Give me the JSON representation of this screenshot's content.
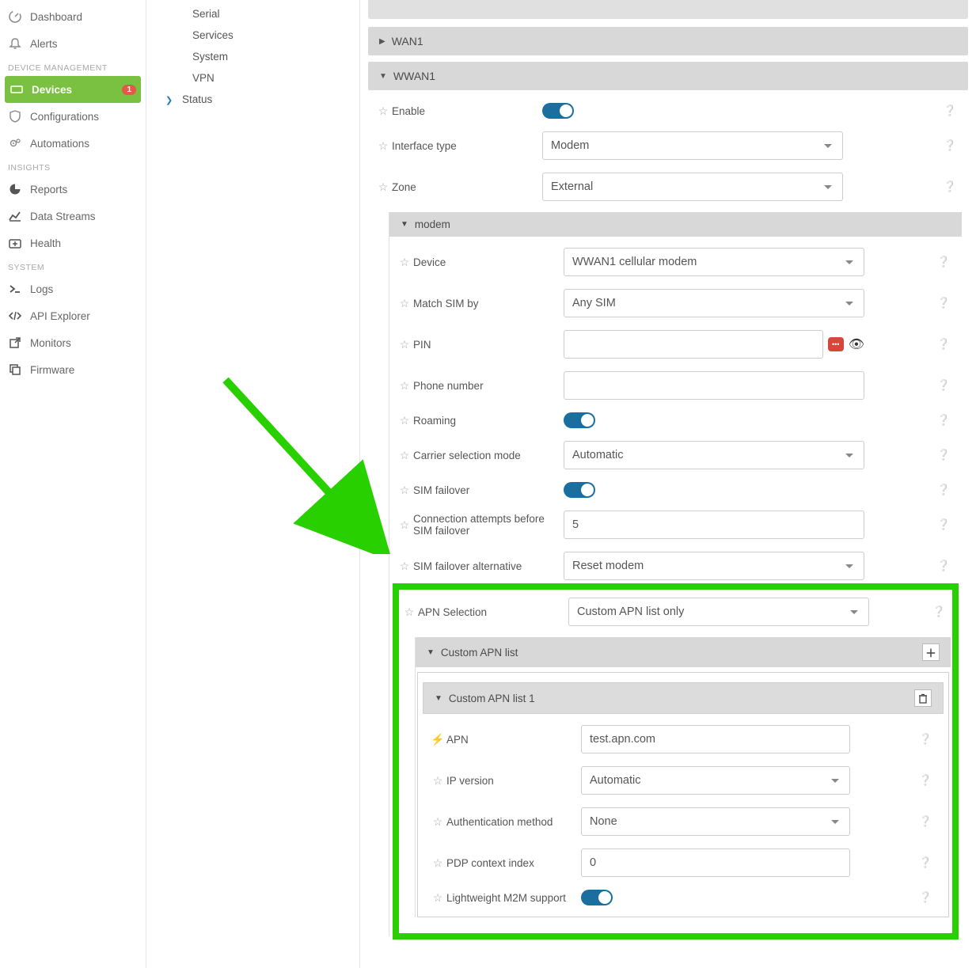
{
  "nav": {
    "top": [
      {
        "icon": "dashboard",
        "label": "Dashboard"
      },
      {
        "icon": "bell",
        "label": "Alerts"
      }
    ],
    "deviceMgmt": {
      "title": "DEVICE MANAGEMENT",
      "items": [
        {
          "icon": "device",
          "label": "Devices",
          "badge": "1",
          "active": true
        },
        {
          "icon": "shield",
          "label": "Configurations"
        },
        {
          "icon": "gears",
          "label": "Automations"
        }
      ]
    },
    "insights": {
      "title": "INSIGHTS",
      "items": [
        {
          "icon": "pie",
          "label": "Reports"
        },
        {
          "icon": "chart",
          "label": "Data Streams"
        },
        {
          "icon": "firstaid",
          "label": "Health"
        }
      ]
    },
    "system": {
      "title": "SYSTEM",
      "items": [
        {
          "icon": "terminal",
          "label": "Logs"
        },
        {
          "icon": "code",
          "label": "API Explorer"
        },
        {
          "icon": "external",
          "label": "Monitors"
        },
        {
          "icon": "copy",
          "label": "Firmware"
        }
      ]
    }
  },
  "tree": {
    "items": [
      "Serial",
      "Services",
      "System",
      "VPN"
    ],
    "parent": "Status"
  },
  "panels": {
    "wan1": "WAN1",
    "wwan1": "WWAN1"
  },
  "wwan": {
    "enable": "Enable",
    "ifaceType": {
      "label": "Interface type",
      "value": "Modem"
    },
    "zone": {
      "label": "Zone",
      "value": "External"
    }
  },
  "modem": {
    "head": "modem",
    "device": {
      "label": "Device",
      "value": "WWAN1 cellular modem"
    },
    "matchSim": {
      "label": "Match SIM by",
      "value": "Any SIM"
    },
    "pin": {
      "label": "PIN",
      "value": ""
    },
    "phone": {
      "label": "Phone number",
      "value": ""
    },
    "roaming": "Roaming",
    "carrier": {
      "label": "Carrier selection mode",
      "value": "Automatic"
    },
    "simFailover": "SIM failover",
    "attempts": {
      "label": "Connection attempts before SIM failover",
      "value": "5"
    },
    "failAlt": {
      "label": "SIM failover alternative",
      "value": "Reset modem"
    },
    "apnSel": {
      "label": "APN Selection",
      "value": "Custom APN list only"
    }
  },
  "apnList": {
    "head": "Custom APN list",
    "item1Head": "Custom APN list 1",
    "apn": {
      "label": "APN",
      "value": "test.apn.com"
    },
    "ipver": {
      "label": "IP version",
      "value": "Automatic"
    },
    "auth": {
      "label": "Authentication method",
      "value": "None"
    },
    "pdp": {
      "label": "PDP context index",
      "value": "0"
    },
    "lwm2m": "Lightweight M2M support"
  }
}
